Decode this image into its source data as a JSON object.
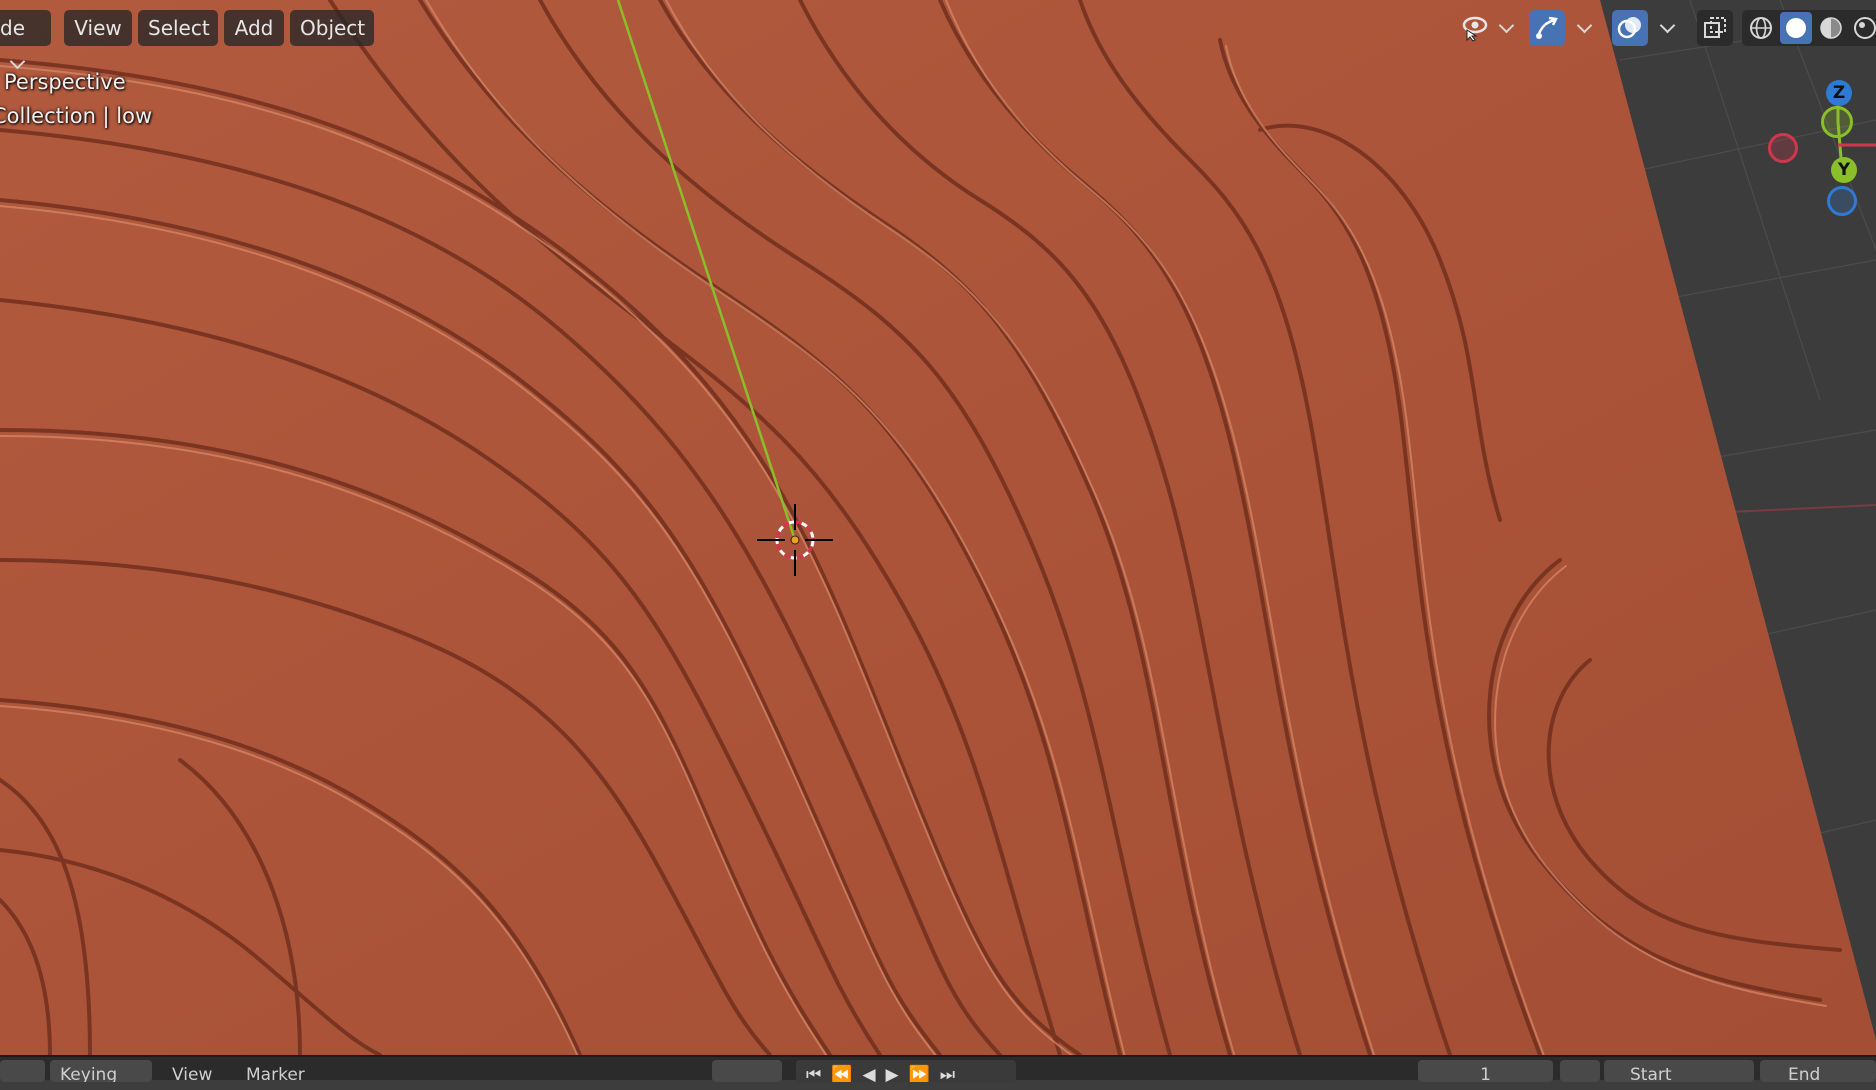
{
  "header": {
    "mode_label": "de",
    "menu": {
      "view": "View",
      "select": "Select",
      "add": "Add",
      "object": "Object"
    }
  },
  "viewport_info": {
    "view_name": "Perspective",
    "collection": "Collection | low"
  },
  "gizmo": {
    "z_label": "Z",
    "y_label": "Y"
  },
  "timeline": {
    "keying_label": "Keying",
    "view_label": "View",
    "marker_label": "Marker",
    "frame_value": "1",
    "start_label": "Start",
    "end_label": "End"
  },
  "colors": {
    "surface": "#b0583e",
    "y_axis": "#8bbf2a",
    "x_axis": "#d2364d",
    "z_axis": "#2f7ad4",
    "active_tool": "#4772b3"
  }
}
